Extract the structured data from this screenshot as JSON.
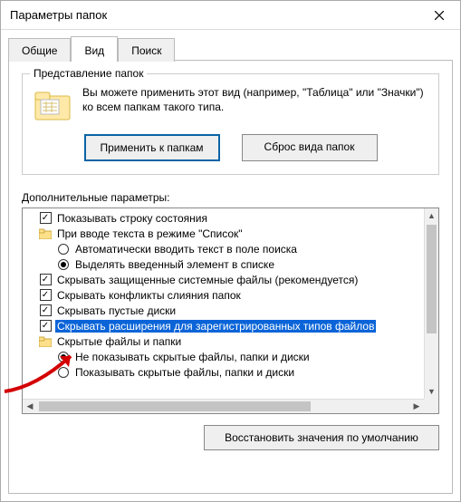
{
  "window": {
    "title": "Параметры папок"
  },
  "tabs": {
    "general": "Общие",
    "view": "Вид",
    "search": "Поиск"
  },
  "folder_views": {
    "legend": "Представление папок",
    "text": "Вы можете применить этот вид (например, \"Таблица\" или \"Значки\") ко всем папкам такого типа.",
    "apply_btn": "Применить к папкам",
    "reset_btn": "Сброс вида папок"
  },
  "advanced": {
    "label": "Дополнительные параметры:",
    "items": {
      "show_status_bar": "Показывать строку состояния",
      "list_typing_group": "При вводе текста в режиме \"Список\"",
      "auto_type_search": "Автоматически вводить текст в поле поиска",
      "select_typed_item": "Выделять введенный элемент в списке",
      "hide_protected_os": "Скрывать защищенные системные файлы (рекомендуется)",
      "hide_merge_conflicts": "Скрывать конфликты слияния папок",
      "hide_empty_drives": "Скрывать пустые диски",
      "hide_extensions": "Скрывать расширения для зарегистрированных типов файлов",
      "hidden_files_group": "Скрытые файлы и папки",
      "dont_show_hidden": "Не показывать скрытые файлы, папки и диски",
      "show_hidden": "Показывать скрытые файлы, папки и диски"
    }
  },
  "restore_defaults": "Восстановить значения по умолчанию"
}
